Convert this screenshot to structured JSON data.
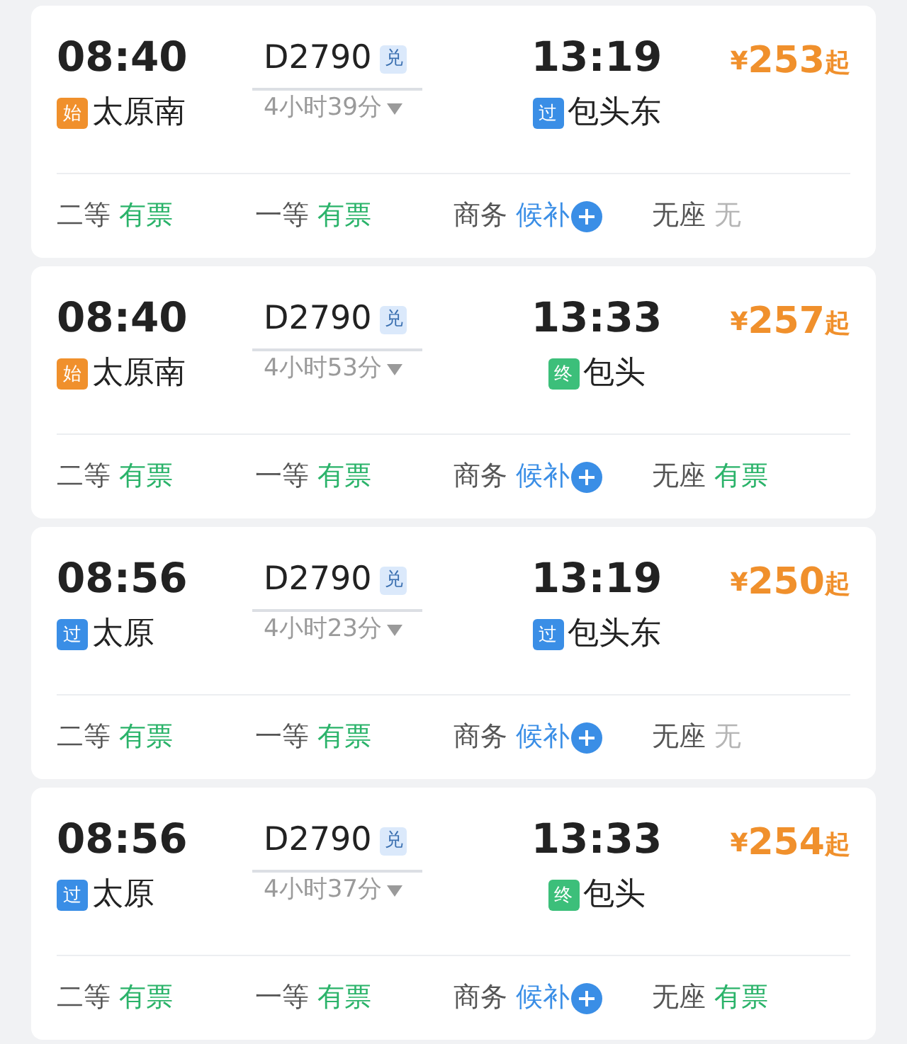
{
  "trains": [
    {
      "depart_time": "08:40",
      "depart_station": {
        "tag": "始",
        "color": "#f0902c",
        "name": "太原南"
      },
      "code": "D2790",
      "code_badge": "兑",
      "duration": "4小时39分",
      "arrive_time": "13:19",
      "arrive_station": {
        "tag": "过",
        "color": "#3a8ee6",
        "name": "包头东"
      },
      "price_symbol": "¥",
      "price": "253",
      "price_suffix": "起",
      "seats": [
        {
          "class": "二等",
          "status": "有票",
          "kind": "available"
        },
        {
          "class": "一等",
          "status": "有票",
          "kind": "available"
        },
        {
          "class": "商务",
          "status": "候补",
          "kind": "waitlist"
        },
        {
          "class": "无座",
          "status": "无",
          "kind": "none"
        }
      ]
    },
    {
      "depart_time": "08:40",
      "depart_station": {
        "tag": "始",
        "color": "#f0902c",
        "name": "太原南"
      },
      "code": "D2790",
      "code_badge": "兑",
      "duration": "4小时53分",
      "arrive_time": "13:33",
      "arrive_station": {
        "tag": "终",
        "color": "#3cbf7a",
        "name": "包头"
      },
      "price_symbol": "¥",
      "price": "257",
      "price_suffix": "起",
      "seats": [
        {
          "class": "二等",
          "status": "有票",
          "kind": "available"
        },
        {
          "class": "一等",
          "status": "有票",
          "kind": "available"
        },
        {
          "class": "商务",
          "status": "候补",
          "kind": "waitlist"
        },
        {
          "class": "无座",
          "status": "有票",
          "kind": "available"
        }
      ]
    },
    {
      "depart_time": "08:56",
      "depart_station": {
        "tag": "过",
        "color": "#3a8ee6",
        "name": "太原"
      },
      "code": "D2790",
      "code_badge": "兑",
      "duration": "4小时23分",
      "arrive_time": "13:19",
      "arrive_station": {
        "tag": "过",
        "color": "#3a8ee6",
        "name": "包头东"
      },
      "price_symbol": "¥",
      "price": "250",
      "price_suffix": "起",
      "seats": [
        {
          "class": "二等",
          "status": "有票",
          "kind": "available"
        },
        {
          "class": "一等",
          "status": "有票",
          "kind": "available"
        },
        {
          "class": "商务",
          "status": "候补",
          "kind": "waitlist"
        },
        {
          "class": "无座",
          "status": "无",
          "kind": "none"
        }
      ]
    },
    {
      "depart_time": "08:56",
      "depart_station": {
        "tag": "过",
        "color": "#3a8ee6",
        "name": "太原"
      },
      "code": "D2790",
      "code_badge": "兑",
      "duration": "4小时37分",
      "arrive_time": "13:33",
      "arrive_station": {
        "tag": "终",
        "color": "#3cbf7a",
        "name": "包头"
      },
      "price_symbol": "¥",
      "price": "254",
      "price_suffix": "起",
      "seats": [
        {
          "class": "二等",
          "status": "有票",
          "kind": "available"
        },
        {
          "class": "一等",
          "status": "有票",
          "kind": "available"
        },
        {
          "class": "商务",
          "status": "候补",
          "kind": "waitlist"
        },
        {
          "class": "无座",
          "status": "有票",
          "kind": "available"
        }
      ]
    }
  ]
}
